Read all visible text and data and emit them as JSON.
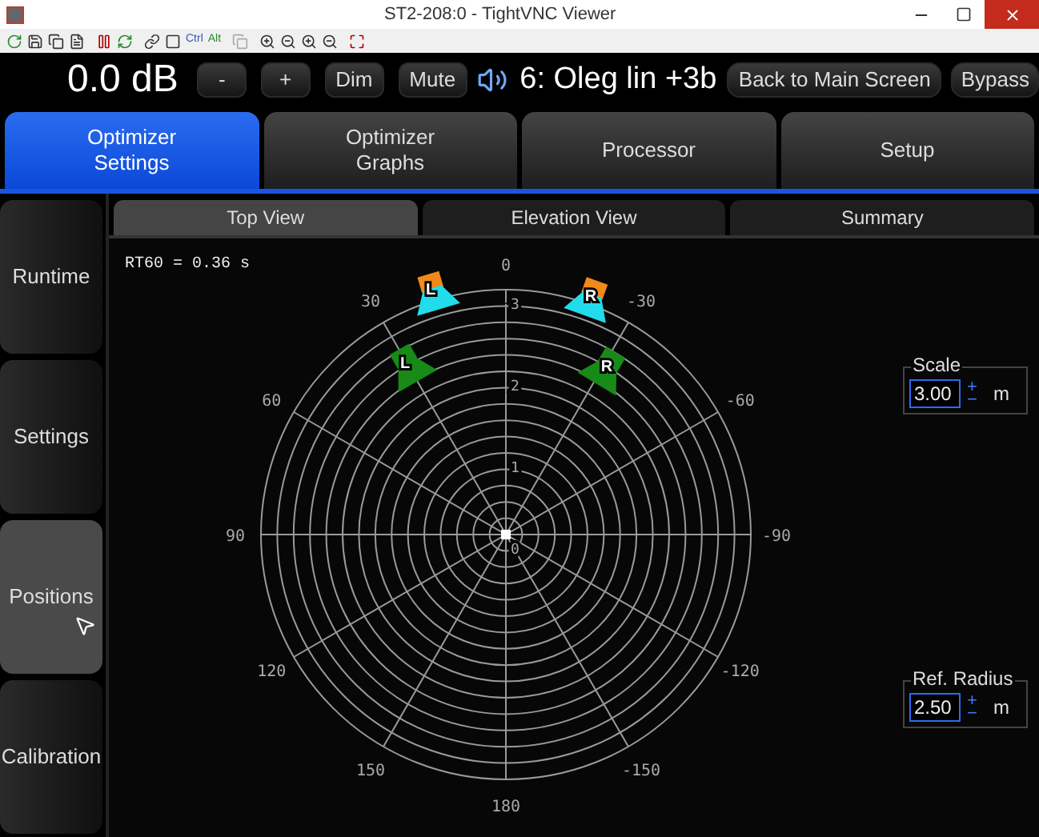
{
  "window": {
    "title": "ST2-208:0 - TightVNC Viewer"
  },
  "toolbar": {
    "ctrl": "Ctrl",
    "alt": "Alt"
  },
  "top_bar": {
    "volume": "0.0 dB",
    "buttons": [
      "-",
      "+",
      "Dim",
      "Mute"
    ],
    "preset": "6: Oleg lin +3b",
    "back": "Back to Main Screen",
    "bypass": "Bypass"
  },
  "tabs": [
    {
      "label": "Optimizer Settings",
      "selected": true
    },
    {
      "label": "Optimizer Graphs",
      "selected": false
    },
    {
      "label": "Processor",
      "selected": false
    },
    {
      "label": "Setup",
      "selected": false
    }
  ],
  "sidebar": {
    "items": [
      {
        "label": "Runtime",
        "selected": false
      },
      {
        "label": "Settings",
        "selected": false
      },
      {
        "label": "Positions",
        "selected": true
      },
      {
        "label": "Calibration",
        "selected": false
      }
    ]
  },
  "sub_tabs": [
    {
      "label": "Top View",
      "selected": true
    },
    {
      "label": "Elevation View",
      "selected": false
    },
    {
      "label": "Summary",
      "selected": false
    }
  ],
  "plot": {
    "rt60": "RT60 = 0.36 s",
    "angle_labels": [
      "0",
      "-30",
      "-60",
      "-90",
      "-120",
      "-150",
      "180",
      "150",
      "120",
      "90",
      "60",
      "30"
    ],
    "ring_labels": [
      "3",
      "2",
      "1",
      "0"
    ],
    "speakers": [
      {
        "label": "L",
        "kind": "reference",
        "color": "#22dcec"
      },
      {
        "label": "R",
        "kind": "reference",
        "color": "#22dcec"
      },
      {
        "label": "L",
        "kind": "speaker",
        "color": "#178a17"
      },
      {
        "label": "R",
        "kind": "speaker",
        "color": "#178a17"
      }
    ]
  },
  "fields": [
    {
      "label": "Scale",
      "value": "3.00",
      "plus": "+",
      "minus": "−",
      "unit": "m"
    },
    {
      "label": "Ref. Radius",
      "value": "2.50",
      "plus": "+",
      "minus": "−",
      "unit": "m"
    }
  ]
}
